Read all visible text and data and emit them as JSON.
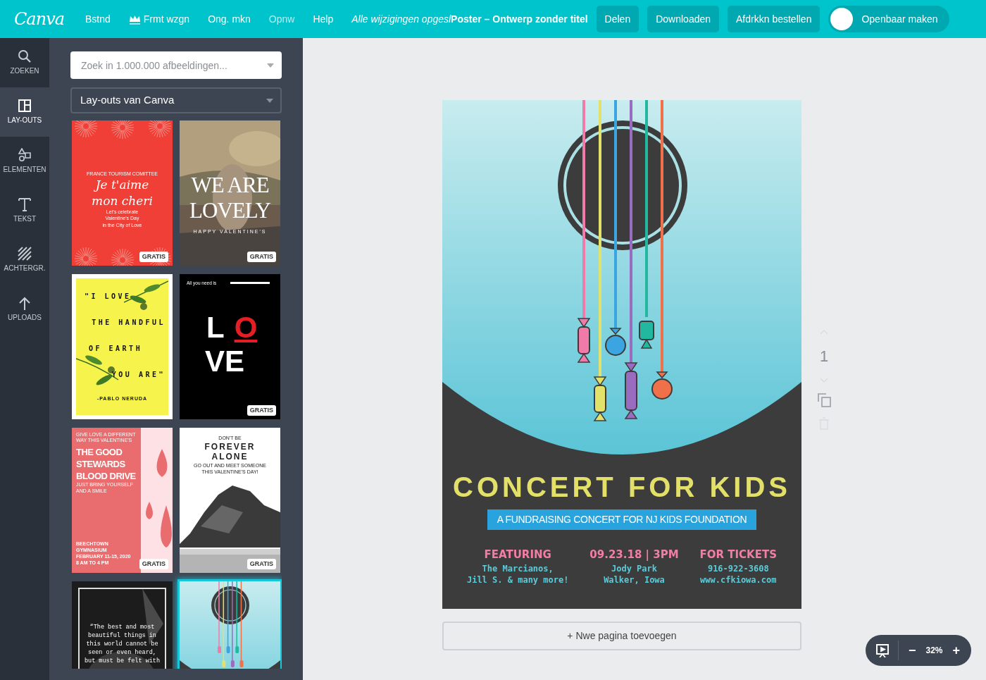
{
  "topbar": {
    "logo": "Canva",
    "menu": [
      {
        "label": "Bstnd",
        "disabled": false
      },
      {
        "label": "Frmt wzgn",
        "disabled": false
      },
      {
        "label": "Ong. mkn",
        "disabled": false
      },
      {
        "label": "Opnw",
        "disabled": true
      },
      {
        "label": "Help",
        "disabled": false
      }
    ],
    "save_status": "Alle wijzigingen opgesl",
    "doc_title": "Poster – Ontwerp zonder titel",
    "buttons": [
      "Delen",
      "Downloaden",
      "Afdrkkn bestellen"
    ],
    "public_toggle": {
      "label": "Openbaar maken",
      "on": false
    }
  },
  "rail": [
    {
      "label": "ZOEKEN",
      "selected": false
    },
    {
      "label": "LAY-OUTS",
      "selected": true
    },
    {
      "label": "ELEMENTEN",
      "selected": false
    },
    {
      "label": "TEKST",
      "selected": false
    },
    {
      "label": "ACHTERGR.",
      "selected": false
    },
    {
      "label": "UPLOADS",
      "selected": false
    }
  ],
  "panel": {
    "search": {
      "placeholder": "Zoek in 1.000.000 afbeeldingen..."
    },
    "source_select": {
      "value": "Lay-outs van Canva"
    },
    "templates": [
      {
        "kind": "red",
        "selected": false,
        "badge": "GRATIS",
        "lines": [
          {
            "kind": "caption",
            "text": "FRANCE TOURISM COMITTEE"
          },
          {
            "kind": "script",
            "text": "Je t'aime"
          },
          {
            "kind": "script",
            "text": "mon cheri"
          },
          {
            "kind": "caption",
            "text": "Let's celebrate"
          },
          {
            "kind": "caption",
            "text": "Valentine's Day"
          },
          {
            "kind": "caption",
            "text": "in the City of Love"
          }
        ]
      },
      {
        "selected": false,
        "badge": "GRATIS",
        "lines": [
          {
            "kind": "headline",
            "text": "WE ARE"
          },
          {
            "kind": "headline",
            "text": "LOVELY"
          },
          {
            "kind": "spaced",
            "text": "HAPPY VALENTINE'S"
          }
        ]
      },
      {
        "kind": "yellow",
        "selected": false,
        "lines": [
          {
            "kind": "spaced",
            "text": "\"I LOVE"
          },
          {
            "kind": "spaced",
            "text": "THE HANDFUL"
          },
          {
            "kind": "spaced",
            "text": "OF EARTH"
          },
          {
            "kind": "spaced",
            "text": "YOU ARE\""
          },
          {
            "kind": "caption",
            "text": "-PABLO NERUDA"
          }
        ]
      },
      {
        "kind": "black",
        "selected": false,
        "badge": "GRATIS",
        "lines": [
          {
            "kind": "caption",
            "text": "All you need is"
          },
          {
            "kind": "letter",
            "text": "L"
          },
          {
            "kind": "accent",
            "text": "O"
          },
          {
            "kind": "headline",
            "text": "VE"
          }
        ]
      },
      {
        "kind": "pink",
        "selected": false,
        "badge": "GRATIS",
        "lines": [
          {
            "kind": "caption",
            "text": "GIVE LOVE A DIFFERENT WAY THIS VALENTINE'S"
          },
          {
            "kind": "headline",
            "text": "THE GOOD"
          },
          {
            "kind": "headline",
            "text": "STEWARDS"
          },
          {
            "kind": "headline",
            "text": "BLOOD DRIVE"
          },
          {
            "kind": "caption",
            "text": "JUST BRING YOURSELF AND A SMILE"
          },
          {
            "kind": "footer",
            "text": "BEECHTOWN GYMNASIUM"
          },
          {
            "kind": "footer",
            "text": "FEBRUARY 11-15, 2020"
          },
          {
            "kind": "footer",
            "text": "8 AM TO 4 PM"
          }
        ]
      },
      {
        "kind": "white",
        "selected": false,
        "badge": "GRATIS",
        "lines": [
          {
            "kind": "caption",
            "text": "DON'T BE"
          },
          {
            "kind": "headline",
            "text": "FOREVER"
          },
          {
            "kind": "headline",
            "text": "ALONE"
          },
          {
            "kind": "caption",
            "text": "GO OUT AND MEET SOMEONE"
          },
          {
            "kind": "caption",
            "text": "THIS VALENTINE'S DAY!"
          }
        ]
      },
      {
        "kind": "dark",
        "selected": false,
        "lines": [
          {
            "kind": "quote",
            "text": "“The best and most beautiful things in this world cannot be seen or even heard, but must be felt with"
          }
        ]
      },
      {
        "kind": "guitar",
        "selected": true
      }
    ]
  },
  "poster": {
    "title": "CONCERT FOR KIDS",
    "subtitle": "A FUNDRAISING CONCERT FOR NJ KIDS FOUNDATION",
    "columns": [
      {
        "heading": "FEATURING",
        "lines": [
          "The Marcianos,",
          "Jill S. & many more!"
        ]
      },
      {
        "heading": "09.23.18 | 3PM",
        "lines": [
          "Jody Park",
          "Walker, Iowa"
        ]
      },
      {
        "heading": "FOR TICKETS",
        "lines": [
          "916-922-3608",
          "www.cfkiowa.com"
        ]
      }
    ]
  },
  "add_page": "+ Nwe pagina toevoegen",
  "page_tools": {
    "page_number": "1"
  },
  "zoom": {
    "minus": "−",
    "value": "32%",
    "plus": "+"
  }
}
